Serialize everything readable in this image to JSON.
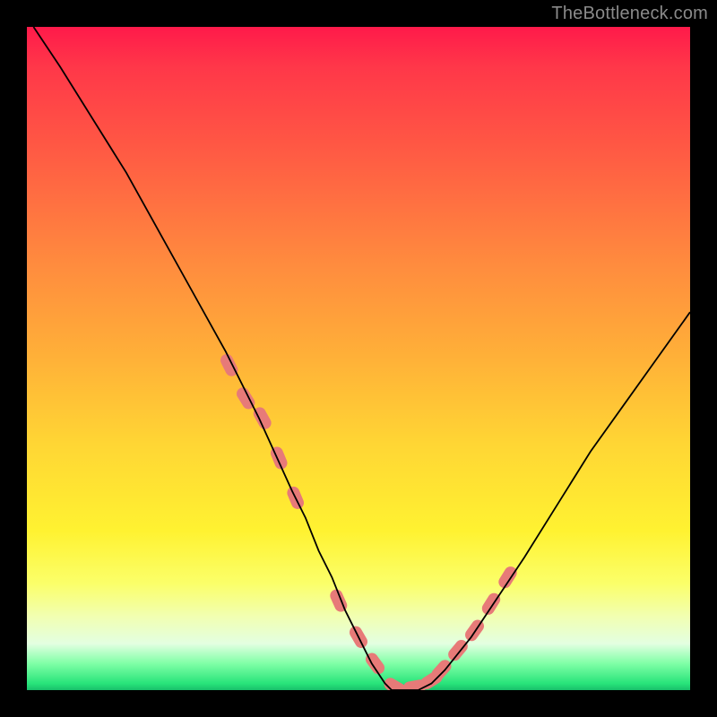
{
  "watermark": "TheBottleneck.com",
  "chart_data": {
    "type": "line",
    "title": "",
    "xlabel": "",
    "ylabel": "",
    "xlim": [
      0,
      100
    ],
    "ylim": [
      0,
      100
    ],
    "grid": false,
    "series": [
      {
        "name": "curve",
        "color": "#000000",
        "stroke_width": 1.8,
        "x": [
          1,
          5,
          10,
          15,
          20,
          25,
          30,
          35,
          40,
          42,
          44,
          46,
          48,
          50,
          52,
          54,
          55,
          57,
          59,
          61,
          63,
          67,
          71,
          75,
          80,
          85,
          90,
          95,
          100
        ],
        "y": [
          100,
          94,
          86,
          78,
          69,
          60,
          51,
          41,
          30,
          26,
          21,
          17,
          12,
          8,
          4,
          1,
          0,
          0,
          0,
          1,
          3,
          8,
          14,
          20,
          28,
          36,
          43,
          50,
          57
        ]
      },
      {
        "name": "highlight-dots",
        "color": "#e77a78",
        "marker": "pill",
        "x": [
          30.5,
          33,
          35.5,
          38,
          40.5,
          47,
          50,
          52.5,
          55.5,
          58.5,
          61,
          62.5,
          65,
          67.5,
          70,
          72.5
        ],
        "y": [
          49,
          44,
          41,
          35,
          29,
          13.5,
          8,
          4,
          0.5,
          0.5,
          1.5,
          3,
          6,
          9,
          13,
          17
        ]
      }
    ]
  }
}
